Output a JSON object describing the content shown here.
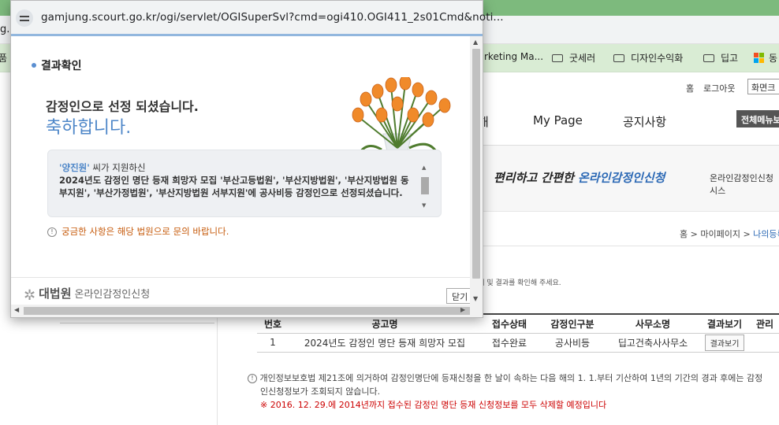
{
  "background": {
    "address_partial": "g.s",
    "bookmarks": [
      {
        "label": "품",
        "icon": "folder-icon"
      },
      {
        "label": "rketing Ma...",
        "icon": "none"
      },
      {
        "label": "굿세러",
        "icon": "folder-icon"
      },
      {
        "label": "디자인수익화",
        "icon": "folder-icon"
      },
      {
        "label": "딥고",
        "icon": "folder-icon"
      },
      {
        "label": "동",
        "icon": "microsoft-icon"
      }
    ],
    "util": {
      "home": "홈",
      "logout": "로그아웃",
      "screen_btn": "화면크"
    },
    "gnb": {
      "item_partial": "해",
      "mypage": "My Page",
      "notice": "공지사항",
      "all_menu": "전체메뉴보"
    },
    "banner": {
      "script_a": "편리하고 간편한 ",
      "script_b": "온라인감정인신청",
      "subtitle": "온라인감정인신청시스"
    },
    "breadcrumb": {
      "home": "홈",
      "sep1": " > ",
      "mypage": "마이페이지",
      "sep2": " > ",
      "current": "나의등록"
    },
    "desc": "상태 및 결과를 확인해 주세요.",
    "table": {
      "headers": [
        "번호",
        "공고명",
        "접수상태",
        "감정인구분",
        "사무소명",
        "결과보기",
        "관리"
      ],
      "rows": [
        {
          "no": "1",
          "title": "2024년도 감정인 명단 등재 희망자 모집",
          "status": "접수완료",
          "type": "공사비등",
          "office": "딥고건축사사무소",
          "result_btn": "결과보기",
          "manage": ""
        }
      ]
    },
    "notice": {
      "line1": "개인정보보호법 제21조에 의거하여 감정인명단에 등재신청을 한 날이 속하는 다음 해의 1. 1.부터 기산하여 1년의 기간의 경과 후에는 감정",
      "line2": "인신청정보가 조회되지 않습니다.",
      "line3": "※ 2016. 12. 29.에 2014년까지 접수된 감정인 명단 등재 신청정보를 모두 삭제할 예정입니다"
    }
  },
  "popup": {
    "url": "gamjung.scourt.go.kr/ogi/servlet/OGISuperSvl?cmd=ogi410.OGI411_2s01Cmd&noti...",
    "section_title": "결과확인",
    "selected_line": "감정인으로 선정 되셨습니다.",
    "congrats": "축하합니다.",
    "message": {
      "name": "'양진원'",
      "name_suffix": " 씨가 지원하신",
      "body": "2024년도 감정인 명단 등재 희망자 모집 '부산고등법원', '부산지방법원', '부산지방법원 동부지원', '부산가정법원', '부산지방법원 서부지원'에 공사비등 감정인으로 선정되셨습니다."
    },
    "hint": "궁금한 사항은 해당 법원으로 문의 바랍니다.",
    "footer": {
      "logo_main": "대법원",
      "logo_sub": "온라인감정인신청",
      "close_btn": "닫기"
    }
  },
  "colors": {
    "accent_blue": "#4d86c8",
    "hint_orange": "#c65a0b",
    "warning_red": "#cc0000",
    "browser_green": "#7dba7d"
  }
}
